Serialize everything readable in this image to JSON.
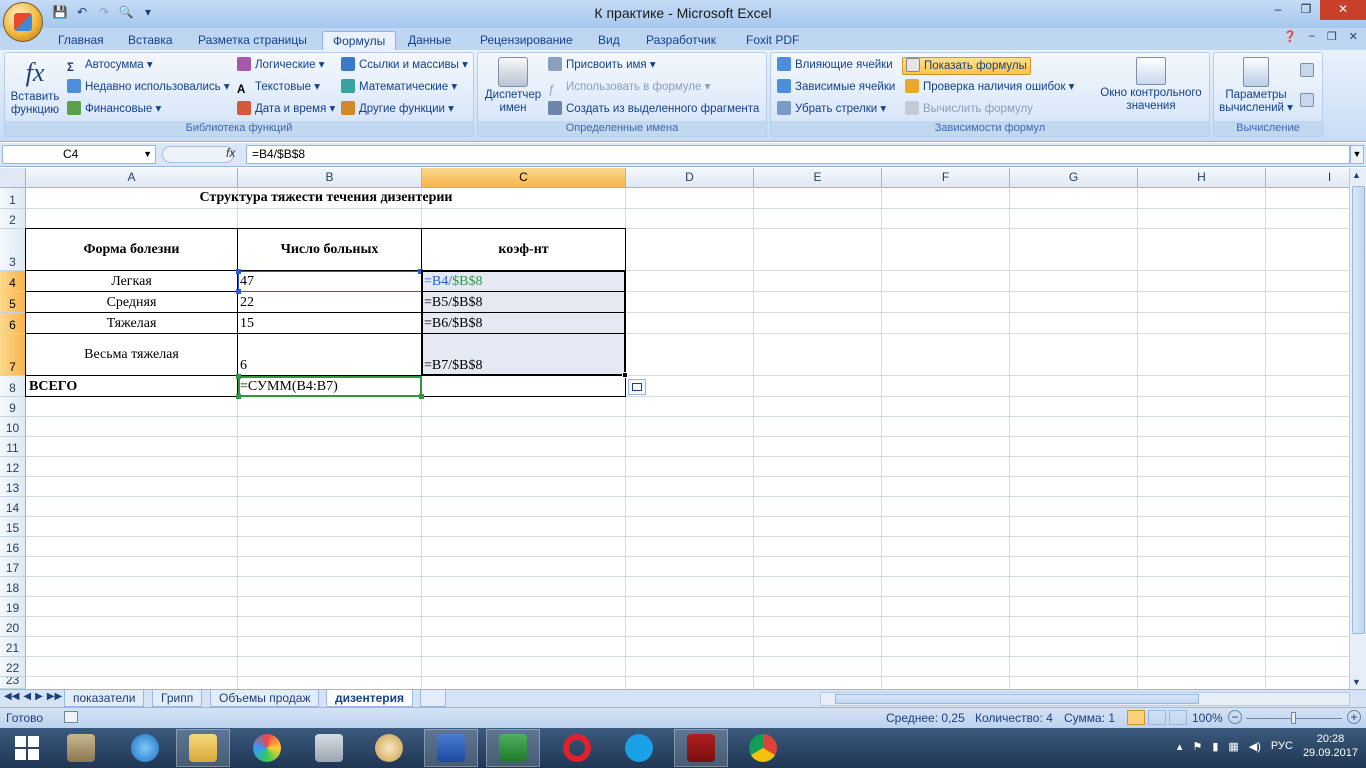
{
  "window": {
    "title": "К практике - Microsoft Excel",
    "controls": [
      "–",
      "❐",
      "✕"
    ]
  },
  "ribbon_tabs": [
    "Главная",
    "Вставка",
    "Разметка страницы",
    "Формулы",
    "Данные",
    "Рецензирование",
    "Вид",
    "Разработчик",
    "Foxit PDF"
  ],
  "active_tab": "Формулы",
  "ribbon": {
    "func_library": {
      "label": "Библиотека функций",
      "insert_function": "Вставить функцию",
      "autosum": "Автосумма",
      "recent": "Недавно использовались",
      "financial": "Финансовые",
      "logical": "Логические",
      "text": "Текстовые",
      "datetime": "Дата и время",
      "lookup": "Ссылки и массивы",
      "math": "Математические",
      "other": "Другие функции"
    },
    "defined_names": {
      "label": "Определенные имена",
      "manager": "Диспетчер имен",
      "define": "Присвоить имя",
      "use_in_formula": "Использовать в формуле",
      "create_from_selection": "Создать из выделенного фрагмента"
    },
    "auditing": {
      "label": "Зависимости формул",
      "trace_precedents": "Влияющие ячейки",
      "trace_dependents": "Зависимые ячейки",
      "remove_arrows": "Убрать стрелки",
      "show_formulas": "Показать формулы",
      "error_checking": "Проверка наличия ошибок",
      "evaluate": "Вычислить формулу",
      "watch_window": "Окно контрольного значения"
    },
    "calculation": {
      "label": "Вычисление",
      "options": "Параметры вычислений"
    }
  },
  "formula_bar": {
    "name_box": "C4",
    "fx": "fx",
    "formula": "=B4/$B$8"
  },
  "columns": [
    "A",
    "B",
    "C",
    "D",
    "E",
    "F",
    "G",
    "H",
    "I"
  ],
  "rows": [
    "1",
    "2",
    "3",
    "4",
    "5",
    "6",
    "7",
    "8",
    "9",
    "10",
    "11",
    "12",
    "13",
    "14",
    "15",
    "16",
    "17",
    "18",
    "19",
    "20",
    "21",
    "22",
    "23"
  ],
  "sheet": {
    "title": "Структура тяжести течения дизентерии",
    "headers": [
      "Форма болезни",
      "Число больных",
      "коэф-нт"
    ],
    "data_rows": [
      {
        "form": "Легкая",
        "count": "47"
      },
      {
        "form": "Средняя",
        "count": "22"
      },
      {
        "form": "Тяжелая",
        "count": "15"
      },
      {
        "form": "Весьма тяжелая",
        "count": "6"
      }
    ],
    "c4_part1": "=B4/",
    "c4_part2": "$B$8",
    "c5": "=B5/$B$8",
    "c6": "=B6/$B$8",
    "c7": "=B7/$B$8",
    "total_label": "ВСЕГО",
    "total_formula": "=СУММ(B4:B7)"
  },
  "sheet_tabs": [
    "показатели",
    "Грипп",
    "Объемы продаж",
    "дизентерия"
  ],
  "active_sheet": "дизентерия",
  "status": {
    "ready": "Готово",
    "average": "Среднее: 0,25",
    "count": "Количество: 4",
    "sum": "Сумма: 1",
    "zoom": "100%"
  },
  "taskbar": {
    "lang": "РУС",
    "time": "20:28",
    "date": "29.09.2017"
  }
}
